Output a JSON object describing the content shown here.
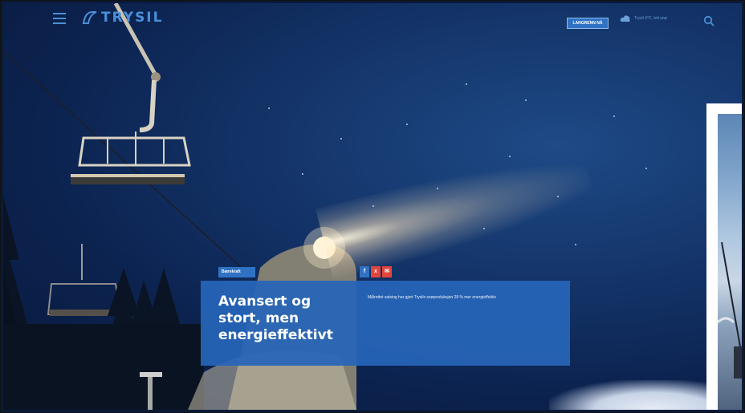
{
  "header": {
    "logo_text": "TRYSIL",
    "book_button": "LANGRENN NÅ",
    "weather_text": "Trysil 4°C, lett snø",
    "icons": [
      "menu-icon",
      "trysil-logo-mark",
      "cloud-icon",
      "search-icon"
    ]
  },
  "article": {
    "category_badge": "Bærekraft",
    "title": "Avansert og stort, men energieffektivt",
    "description": "Målrettet satsing har gjort Trysils snøproduksjon 28 % mer energieffektiv"
  },
  "social": [
    {
      "label": "f",
      "color": "#2f72c4"
    },
    {
      "label": "x",
      "color": "#e2453c"
    },
    {
      "label": "✉",
      "color": "#e2453c"
    }
  ],
  "colors": {
    "brand_blue": "#2f72c4",
    "card_blue": "#2765b8",
    "night_sky": "#0c2350",
    "accent_red": "#e2453c"
  }
}
